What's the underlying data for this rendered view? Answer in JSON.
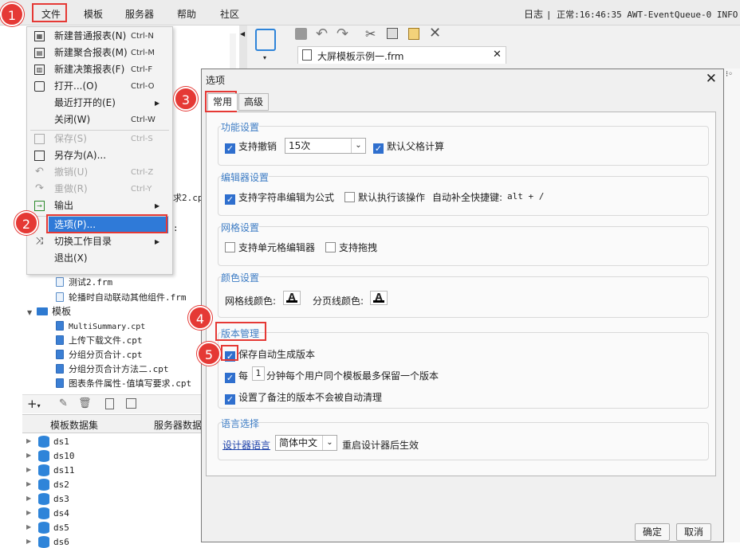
{
  "menubar": {
    "items": [
      "文件",
      "模板",
      "服务器",
      "帮助",
      "社区"
    ],
    "log_label": "日志",
    "log_text": "| 正常:16:46:35 AWT-EventQueue-0 INFO [s"
  },
  "file_menu": {
    "items": [
      {
        "label": "新建普通报表(N)",
        "shortcut": "Ctrl-N",
        "icon": "new-report-icon"
      },
      {
        "label": "新建聚合报表(M)",
        "shortcut": "Ctrl-M",
        "icon": "new-aggregate-report-icon"
      },
      {
        "label": "新建决策报表(F)",
        "shortcut": "Ctrl-F",
        "icon": "new-decision-report-icon"
      },
      {
        "label": "打开...(O)",
        "shortcut": "Ctrl-O",
        "icon": "open-folder-icon"
      },
      {
        "label": "最近打开的(E)",
        "shortcut": "",
        "icon": ""
      },
      {
        "label": "关闭(W)",
        "shortcut": "Ctrl-W",
        "icon": ""
      },
      {
        "label": "保存(S)",
        "shortcut": "Ctrl-S",
        "icon": "save-icon",
        "disabled": true
      },
      {
        "label": "另存为(A)...",
        "shortcut": "",
        "icon": "save-as-icon"
      },
      {
        "label": "撤销(U)",
        "shortcut": "Ctrl-Z",
        "icon": "undo-icon",
        "disabled": true
      },
      {
        "label": "重做(R)",
        "shortcut": "Ctrl-Y",
        "icon": "redo-icon",
        "disabled": true
      },
      {
        "label": "输出",
        "shortcut": "",
        "icon": "export-icon"
      },
      {
        "label": "选项(P)...",
        "shortcut": "",
        "icon": ""
      },
      {
        "label": "切换工作目录",
        "shortcut": "",
        "icon": "switch-dir-icon"
      },
      {
        "label": "退出(X)",
        "shortcut": "",
        "icon": ""
      }
    ]
  },
  "file_tree": {
    "partial_1": "求2.cpt",
    "partial_2": ":",
    "items": [
      "测试2.frm",
      "轮播时自动联动其他组件.frm"
    ],
    "folder": "模板",
    "folder_items": [
      "MultiSummary.cpt",
      "上传下载文件.cpt",
      "分组分页合计.cpt",
      "分组分页合计方法二.cpt",
      "图表条件属性-值填写要求.cpt"
    ]
  },
  "dataset_tabs": {
    "tab1": "模板数据集",
    "tab2": "服务器数据"
  },
  "datasets": [
    "ds1",
    "ds10",
    "ds11",
    "ds2",
    "ds3",
    "ds4",
    "ds5",
    "ds6"
  ],
  "doc_tab": {
    "title": "大屏模板示例一.frm"
  },
  "dialog": {
    "title": "选项",
    "tabs": [
      "常用",
      "高级"
    ],
    "groups": {
      "function": {
        "title": "功能设置",
        "support_undo": "支持撤销",
        "undo_count": "15次",
        "default_parent_calc": "默认父格计算"
      },
      "editor": {
        "title": "编辑器设置",
        "string_formula": "支持字符串编辑为公式",
        "default_exec": "默认执行该操作",
        "autocomplete_label": "自动补全快捷键:",
        "autocomplete_key": "alt + /"
      },
      "grid": {
        "title": "网格设置",
        "cell_editor": "支持单元格编辑器",
        "drag": "支持拖拽"
      },
      "color": {
        "title": "颜色设置",
        "grid_line_color": "网格线颜色:",
        "page_line_color": "分页线颜色:"
      },
      "version": {
        "title": "版本管理",
        "save_auto": "保存自动生成版本",
        "every_prefix": "每",
        "minutes": "1",
        "every_suffix": "分钟每个用户同个模板最多保留一个版本",
        "remark_keep": "设置了备注的版本不会被自动清理"
      },
      "language": {
        "title": "语言选择",
        "label": "设计器语言",
        "value": "简体中文",
        "note": "重启设计器后生效"
      }
    },
    "ok": "确定",
    "cancel": "取消"
  },
  "markers": [
    "1",
    "2",
    "3",
    "4",
    "5"
  ],
  "colors": {
    "accent": "#2f6fce",
    "marker": "#e53935",
    "group_title": "#3d7cc4"
  }
}
